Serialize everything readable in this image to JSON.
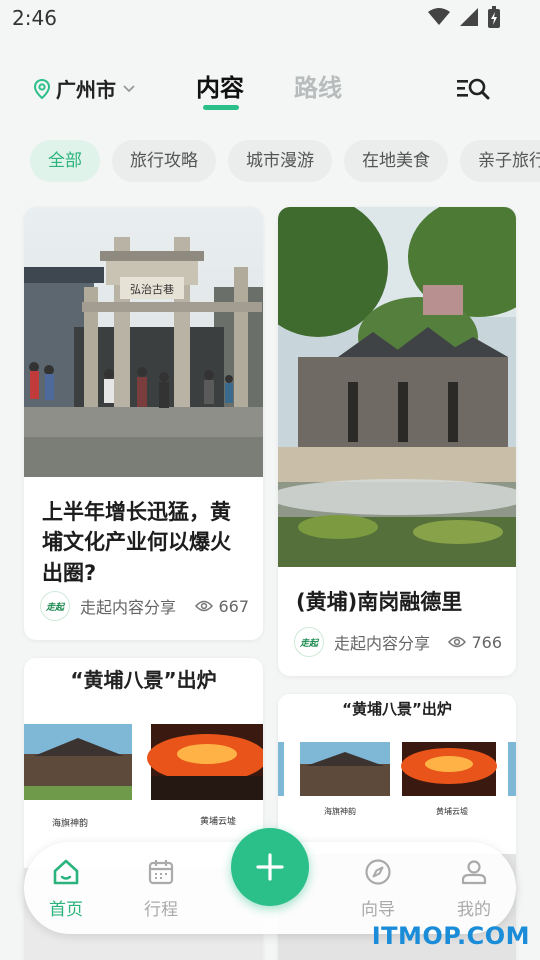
{
  "status_bar": {
    "time": "2:46"
  },
  "header": {
    "city": "广州市",
    "tabs": [
      {
        "label": "内容",
        "active": true
      },
      {
        "label": "路线",
        "active": false
      }
    ]
  },
  "chips": [
    "全部",
    "旅行攻略",
    "城市漫游",
    "在地美食",
    "亲子旅行"
  ],
  "cards": [
    {
      "title": "上半年增长迅猛，黄埔文化产业何以爆火出圈?",
      "author": "走起内容分享",
      "views": "667"
    },
    {
      "title": "(黄埔)南岗融德里",
      "author": "走起内容分享",
      "views": "766"
    },
    {
      "title": "",
      "author": "",
      "views": ""
    },
    {
      "title": "",
      "author": "",
      "views": ""
    }
  ],
  "posters": {
    "heading": "“黄埔八景”出炉",
    "captions": [
      "海旗神韵",
      "黄埔云墟"
    ],
    "captions_small": [
      "海旗神韵",
      "黄埔云墟"
    ]
  },
  "image_sign": "弘治古巷",
  "author_logo_text": "走起",
  "bottom_nav": {
    "items": [
      "首页",
      "行程",
      "向导",
      "我的"
    ]
  },
  "watermark": "ITMOP.COM",
  "colors": {
    "accent": "#2bbf8a",
    "chip_active_bg": "#dff3ea",
    "watermark": "#1a8cd8"
  },
  "icons": [
    "wifi-icon",
    "signal-icon",
    "battery-icon",
    "location-pin-icon",
    "chevron-down-icon",
    "search-list-icon",
    "eye-icon",
    "home-icon",
    "calendar-icon",
    "plus-icon",
    "compass-icon",
    "user-icon"
  ]
}
